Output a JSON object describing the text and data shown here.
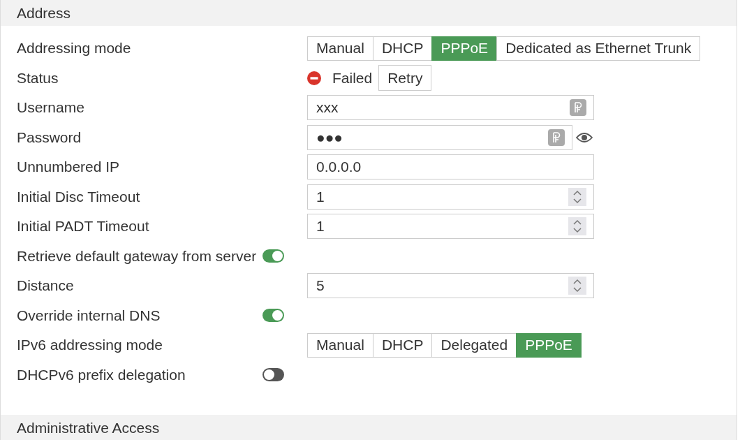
{
  "address_section": {
    "title": "Address",
    "fields": [
      {
        "kind": "segmented",
        "label": "Addressing mode",
        "options": [
          {
            "label": "Manual",
            "selected": false
          },
          {
            "label": "DHCP",
            "selected": false
          },
          {
            "label": "PPPoE",
            "selected": true
          },
          {
            "label": "Dedicated as Ethernet Trunk",
            "selected": false
          }
        ]
      },
      {
        "kind": "status",
        "label": "Status",
        "status_text": "Failed",
        "button": "Retry"
      },
      {
        "kind": "text",
        "label": "Username",
        "value": "xxx",
        "key_icon": true
      },
      {
        "kind": "password",
        "label": "Password",
        "value": "●●●",
        "key_icon": true
      },
      {
        "kind": "text",
        "label": "Unnumbered IP",
        "value": "0.0.0.0",
        "key_icon": false
      },
      {
        "kind": "number",
        "label": "Initial Disc Timeout",
        "value": "1"
      },
      {
        "kind": "number",
        "label": "Initial PADT Timeout",
        "value": "1"
      },
      {
        "kind": "toggle",
        "label": "Retrieve default gateway from server",
        "on": true
      },
      {
        "kind": "number",
        "label": "Distance",
        "value": "5"
      },
      {
        "kind": "toggle",
        "label": "Override internal DNS",
        "on": true
      },
      {
        "kind": "segmented",
        "label": "IPv6 addressing mode",
        "options": [
          {
            "label": "Manual",
            "selected": false
          },
          {
            "label": "DHCP",
            "selected": false
          },
          {
            "label": "Delegated",
            "selected": false
          },
          {
            "label": "PPPoE",
            "selected": true
          }
        ]
      },
      {
        "kind": "toggle",
        "label": "DHCPv6 prefix delegation",
        "on": false
      }
    ]
  },
  "next_section": {
    "title": "Administrative Access"
  }
}
